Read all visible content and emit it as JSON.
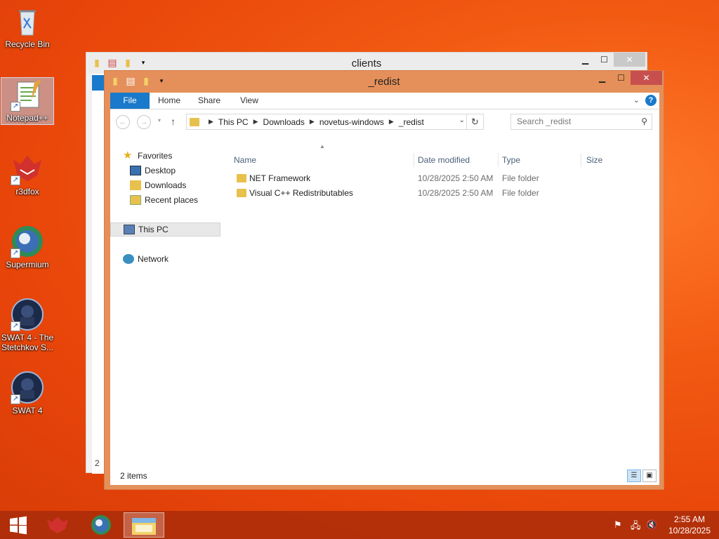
{
  "desktop": {
    "icons": [
      {
        "label": "Recycle Bin",
        "icon": "recycle-bin-icon"
      },
      {
        "label": "Notepad++",
        "icon": "notepad-plus-plus-icon"
      },
      {
        "label": "r3dfox",
        "icon": "r3dfox-icon"
      },
      {
        "label": "Supermium",
        "icon": "supermium-icon"
      },
      {
        "label": "SWAT 4 - The Stetchkov S...",
        "icon": "swat4-icon"
      },
      {
        "label": "SWAT 4",
        "icon": "swat4-icon"
      }
    ]
  },
  "back_window": {
    "title": "clients",
    "partial_status": "2"
  },
  "window": {
    "title": "_redist",
    "ribbon_tabs": [
      "File",
      "Home",
      "Share",
      "View"
    ],
    "breadcrumb": [
      "This PC",
      "Downloads",
      "novetus-windows",
      "_redist"
    ],
    "search_placeholder": "Search _redist",
    "nav_pane": {
      "favorites_label": "Favorites",
      "favorites": [
        "Desktop",
        "Downloads",
        "Recent places"
      ],
      "this_pc": "This PC",
      "network": "Network"
    },
    "columns": [
      "Name",
      "Date modified",
      "Type",
      "Size"
    ],
    "files": [
      {
        "name": "NET Framework",
        "date": "10/28/2025 2:50 AM",
        "type": "File folder",
        "size": ""
      },
      {
        "name": "Visual C++ Redistributables",
        "date": "10/28/2025 2:50 AM",
        "type": "File folder",
        "size": ""
      }
    ],
    "status": "2 items"
  },
  "taskbar": {
    "items": [
      "start-button",
      "r3dfox",
      "Supermium",
      "File Explorer"
    ],
    "time": "2:55 AM",
    "date": "10/28/2025"
  },
  "colors": {
    "accent": "#1979ca",
    "window_frame": "#e5905a",
    "close_button": "#c7504f",
    "desktop_background": "#f25a12"
  }
}
